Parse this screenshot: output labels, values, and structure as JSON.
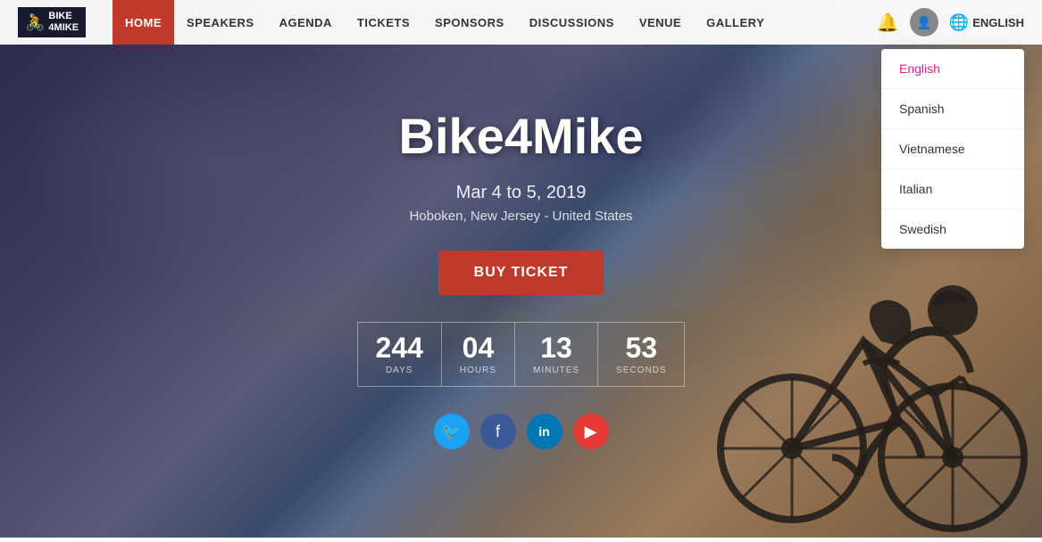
{
  "logo": {
    "text_line1": "BIKE",
    "text_line2": "4MIKE"
  },
  "navbar": {
    "items": [
      {
        "label": "HOME",
        "active": true
      },
      {
        "label": "SPEAKERS",
        "active": false
      },
      {
        "label": "AGENDA",
        "active": false
      },
      {
        "label": "TICKETS",
        "active": false
      },
      {
        "label": "SPONSORS",
        "active": false
      },
      {
        "label": "DISCUSSIONS",
        "active": false
      },
      {
        "label": "VENUE",
        "active": false
      },
      {
        "label": "GALLERY",
        "active": false
      }
    ],
    "language_label": "ENGLISH"
  },
  "lang_dropdown": {
    "options": [
      {
        "label": "English",
        "selected": true
      },
      {
        "label": "Spanish",
        "selected": false
      },
      {
        "label": "Vietnamese",
        "selected": false
      },
      {
        "label": "Italian",
        "selected": false
      },
      {
        "label": "Swedish",
        "selected": false
      }
    ]
  },
  "hero": {
    "title": "Bike4Mike",
    "date": "Mar 4 to 5, 2019",
    "location": "Hoboken, New Jersey - United States",
    "buy_button": "BUY TICKET",
    "countdown": {
      "days_value": "244",
      "days_label": "DAYS",
      "hours_value": "04",
      "hours_label": "HOURS",
      "minutes_value": "13",
      "minutes_label": "MINUTES",
      "seconds_value": "53",
      "seconds_label": "SECONDS"
    }
  },
  "social": {
    "twitter_label": "Twitter",
    "facebook_label": "Facebook",
    "linkedin_label": "LinkedIn",
    "youtube_label": "YouTube"
  },
  "colors": {
    "active_nav": "#c0392b",
    "selected_lang": "#e91e8c",
    "buy_button": "#c0392b"
  }
}
